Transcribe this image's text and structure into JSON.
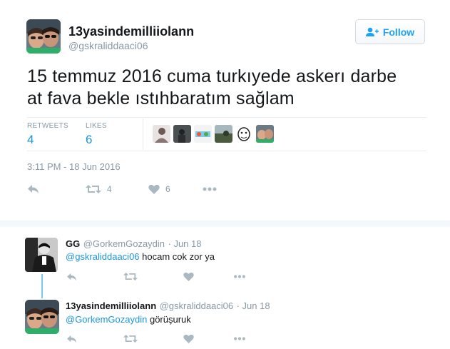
{
  "main_tweet": {
    "display_name": "13yasindemilliiolann",
    "handle": "@gskraliddaaci06",
    "follow_label": "Follow",
    "text_line1": "15 temmuz 2016 cuma turkıyede askerı darbe",
    "text_line2": "at fava bekle ıstıhbaratım sağlam",
    "stats": {
      "retweets_label": "RETWEETS",
      "retweets": "4",
      "likes_label": "LIKES",
      "likes": "6"
    },
    "timestamp": "3:11 PM - 18 Jun 2016",
    "actions": {
      "retweet_count": "4",
      "like_count": "6"
    }
  },
  "replies": [
    {
      "display_name": "GG",
      "handle": "@GorkemGozaydin",
      "date": "· Jun 18",
      "mention": "@gskraliddaaci06",
      "text": " hocam cok zor ya"
    },
    {
      "display_name": "13yasindemilliiolann",
      "handle": "@gskraliddaaci06",
      "date": "· Jun 18",
      "mention": "@GorkemGozaydin",
      "text": " görüşuruk"
    }
  ],
  "colors": {
    "accent": "#1da1f2",
    "link": "#1b95e0",
    "muted": "#8899a6",
    "icon": "#aab8c2"
  },
  "icons": [
    "add-user-icon",
    "reply-icon",
    "retweet-icon",
    "heart-icon",
    "more-icon"
  ]
}
